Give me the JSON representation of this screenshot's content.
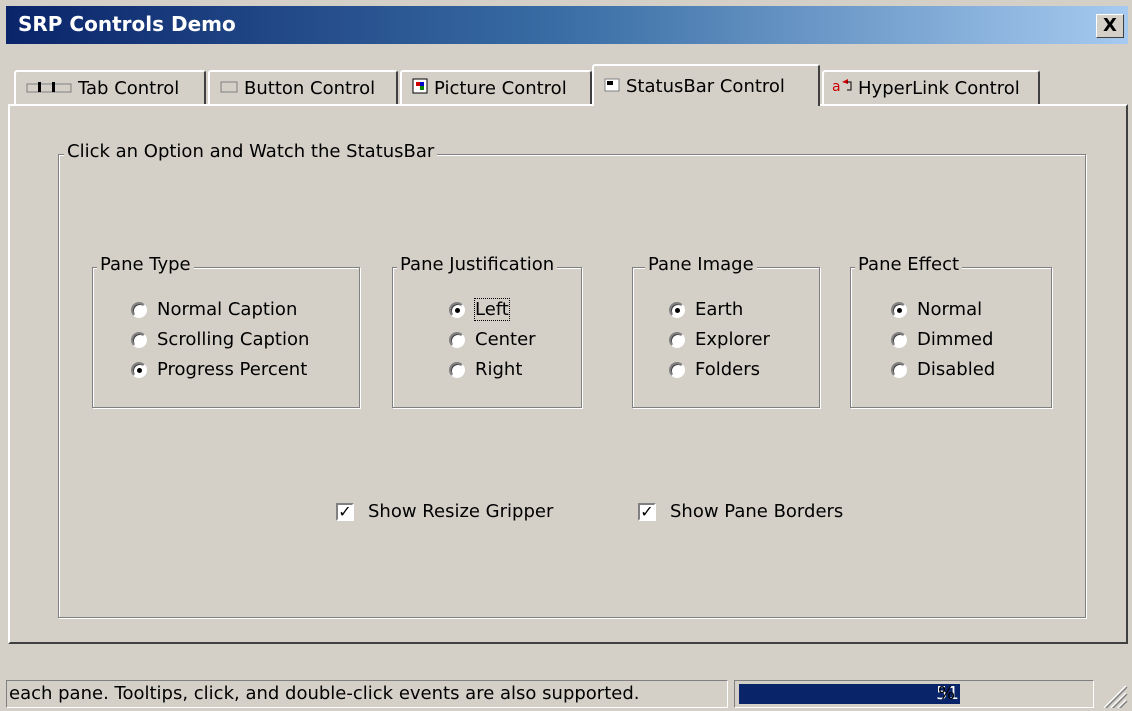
{
  "window": {
    "title": "SRP Controls Demo",
    "close_label": "X"
  },
  "tabs": [
    {
      "label": "Tab Control",
      "icon": "tab-control-icon",
      "active": false
    },
    {
      "label": "Button Control",
      "icon": "button-control-icon",
      "active": false
    },
    {
      "label": "Picture Control",
      "icon": "picture-control-icon",
      "active": false
    },
    {
      "label": "StatusBar Control",
      "icon": "statusbar-control-icon",
      "active": true
    },
    {
      "label": "HyperLink Control",
      "icon": "hyperlink-control-icon",
      "active": false
    }
  ],
  "main_group": {
    "legend": "Click an Option and Watch the StatusBar"
  },
  "pane_type": {
    "legend": "Pane Type",
    "options": [
      "Normal Caption",
      "Scrolling Caption",
      "Progress Percent"
    ],
    "selected": 2
  },
  "pane_justification": {
    "legend": "Pane Justification",
    "options": [
      "Left",
      "Center",
      "Right"
    ],
    "selected": 0
  },
  "pane_image": {
    "legend": "Pane Image",
    "options": [
      "Earth",
      "Explorer",
      "Folders"
    ],
    "selected": 0
  },
  "pane_effect": {
    "legend": "Pane Effect",
    "options": [
      "Normal",
      "Dimmed",
      "Disabled"
    ],
    "selected": 0
  },
  "checkboxes": {
    "show_resize_gripper": {
      "label": "Show Resize Gripper",
      "checked": true
    },
    "show_pane_borders": {
      "label": "Show Pane Borders",
      "checked": true
    }
  },
  "statusbar": {
    "caption": "each pane. Tooltips, click, and double-click events are also supported.",
    "progress_value": "51",
    "progress_suffix": "%",
    "progress_fraction": 0.51
  },
  "colors": {
    "title_start": "#0a246a",
    "title_end": "#a6caf0",
    "progress": "#0a246a",
    "face": "#d4d0c8"
  }
}
